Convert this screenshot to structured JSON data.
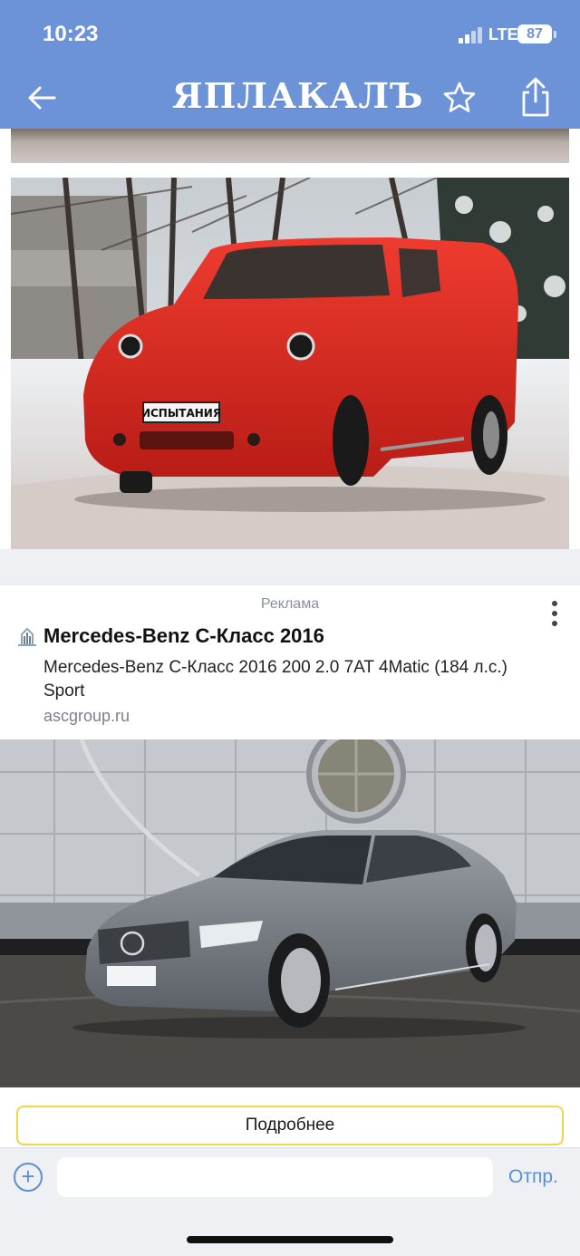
{
  "status_bar": {
    "time": "10:23",
    "network": "LTE",
    "battery": "87"
  },
  "header": {
    "logo_text": "ЯПЛАКАЛЪ",
    "back_icon": "arrow-left-icon",
    "favorite_icon": "star-icon",
    "share_icon": "share-icon",
    "background_color": "#6c93d7"
  },
  "post": {
    "image_plate_text": "ИСПЫТАНИЯ"
  },
  "ad": {
    "label": "Реклама",
    "title": "Mercedes-Benz C-Класс 2016",
    "description": "Mercedes-Benz C-Класс 2016 200 2.0 7AT 4Matic (184 л.с.) Sport",
    "domain": "ascgroup.ru",
    "button_label": "Подробнее",
    "button_border_color": "#f1d54a"
  },
  "compose": {
    "input_placeholder": "",
    "send_label": "Отпр.",
    "accent_color": "#5a8fd8"
  }
}
